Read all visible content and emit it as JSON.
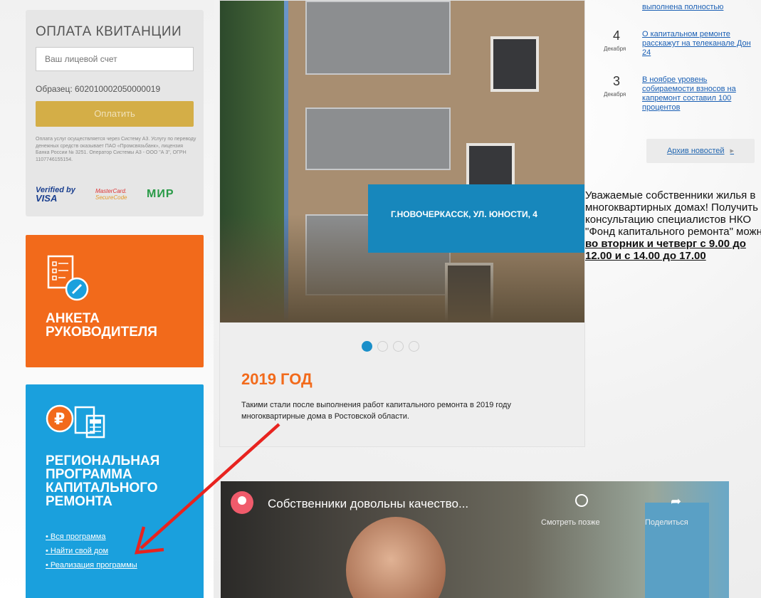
{
  "payment": {
    "title": "ОПЛАТА КВИТАНЦИИ",
    "input_placeholder": "Ваш лицевой счет",
    "sample": "Образец: 602010002050000019",
    "pay_button": "Оплатить",
    "note": "Оплата услуг осуществляется через Систему А3. Услугу по переводу денежных средств оказывает ПАО «Промсвязьбанк», лицензия Банка России № 3251. Оператор Системы А3 - ООО \"А 3\", ОГРН 1107746155154.",
    "logos": {
      "visa_line1": "Verified by",
      "visa_line2": "VISA",
      "mc_line1": "MasterCard.",
      "mc_line2": "SecureCode",
      "mir": "МИР"
    }
  },
  "orange_card": {
    "title": "АНКЕТА РУКОВОДИТЕЛЯ"
  },
  "blue_card": {
    "title": "РЕГИОНАЛЬНАЯ ПРОГРАММА КАПИТАЛЬНОГО РЕМОНТА",
    "links": [
      "Вся программа",
      "Найти свой дом",
      "Реализация программы"
    ]
  },
  "slider": {
    "caption": "Г.НОВОЧЕРКАССК, УЛ. ЮНОСТИ, 4",
    "title": "2019 ГОД",
    "description": "Такими стали после выполнения работ капитального ремонта в 2019 году многоквартирные дома в Ростовской области.",
    "dots": 4,
    "active_dot": 0
  },
  "news": {
    "top_link": "выполнена полностью",
    "items": [
      {
        "day": "4",
        "month": "Декабря",
        "text": "О капитальном ремонте расскажут на телеканале Дон 24"
      },
      {
        "day": "3",
        "month": "Декабря",
        "text": "В ноябре уровень собираемости взносов на капремонт составил 100 процентов"
      }
    ],
    "archive": "Архив новостей"
  },
  "notice": {
    "text": "Уважаемые собственники жилья в многоквартирных домах! Получить консультацию специалистов НКО \"Фонд капитального ремонта\" можно ",
    "bold": "во вторник и четверг с 9.00 до 12.00 и с 14.00 до 17.00"
  },
  "video": {
    "title": "Собственники довольны качество...",
    "watch_later": "Смотреть позже",
    "share": "Поделиться"
  },
  "colors": {
    "orange": "#f26a1b",
    "blue": "#1aa0dd",
    "caption_blue": "#1787bc",
    "pay_gold": "#d4ae47",
    "link": "#1a5fb4",
    "arrow_red": "#e8231f"
  }
}
